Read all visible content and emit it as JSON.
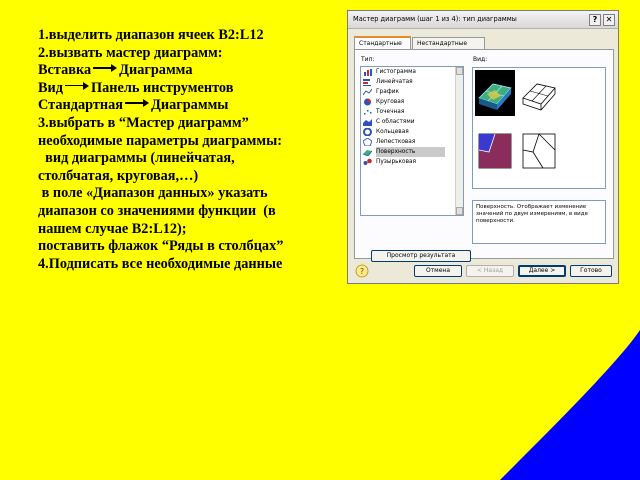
{
  "instructions": [
    {
      "parts": [
        "1.выделить диапазон ячеек B2:L12"
      ]
    },
    {
      "parts": [
        "2.вызвать мастер диаграмм:"
      ]
    },
    {
      "parts": [
        "Вставка",
        "Диаграмма"
      ]
    },
    {
      "parts": [
        "Вид",
        "Панель инструментов"
      ]
    },
    {
      "parts": [
        "Стандартная",
        "Диаграммы"
      ]
    },
    {
      "parts": [
        "3.выбрать в “Мастер диаграмм”"
      ]
    },
    {
      "parts": [
        "необходимые параметры диаграммы:"
      ]
    },
    {
      "parts": [
        "  вид диаграммы (линейчатая,"
      ]
    },
    {
      "parts": [
        "столбчатая, круговая,…)"
      ]
    },
    {
      "parts": [
        " в поле «Диапазон данных» указать"
      ]
    },
    {
      "parts": [
        "диапазон со значениями функции  (в"
      ]
    },
    {
      "parts": [
        "нашем случае B2:L12);"
      ]
    },
    {
      "parts": [
        "поставить флажок “Ряды в столбцах”"
      ]
    },
    {
      "parts": [
        "4.Подписать все необходимые данные"
      ]
    }
  ],
  "dialog": {
    "title": "Мастер диаграмм (шаг 1 из 4): тип диаграммы",
    "help_glyph": "?",
    "close_glyph": "✕",
    "tabs": [
      "Стандартные",
      "Нестандартные"
    ],
    "type_label": "Тип:",
    "view_label": "Вид:",
    "chart_types": [
      {
        "label": "Гистограмма",
        "icon": "column-chart-icon"
      },
      {
        "label": "Линейчатая",
        "icon": "bar-chart-icon"
      },
      {
        "label": "График",
        "icon": "line-chart-icon"
      },
      {
        "label": "Круговая",
        "icon": "pie-chart-icon"
      },
      {
        "label": "Точечная",
        "icon": "scatter-chart-icon"
      },
      {
        "label": "С областями",
        "icon": "area-chart-icon"
      },
      {
        "label": "Кольцевая",
        "icon": "doughnut-chart-icon"
      },
      {
        "label": "Лепестковая",
        "icon": "radar-chart-icon"
      },
      {
        "label": "Поверхность",
        "icon": "surface-chart-icon"
      },
      {
        "label": "Пузырьковая",
        "icon": "bubble-chart-icon"
      }
    ],
    "selected_type": "Поверхность",
    "description": "Поверхность. Отображает изменение значений по двум измерениям, в виде поверхности.",
    "buttons": {
      "preview": "Просмотр результата",
      "cancel": "Отмена",
      "back": "< Назад",
      "next": "Далее >",
      "finish": "Готово"
    }
  },
  "colors": {
    "slide_background": "#ffff00",
    "slide_accent": "#0000ff",
    "dialog_face": "#ece9d8"
  }
}
